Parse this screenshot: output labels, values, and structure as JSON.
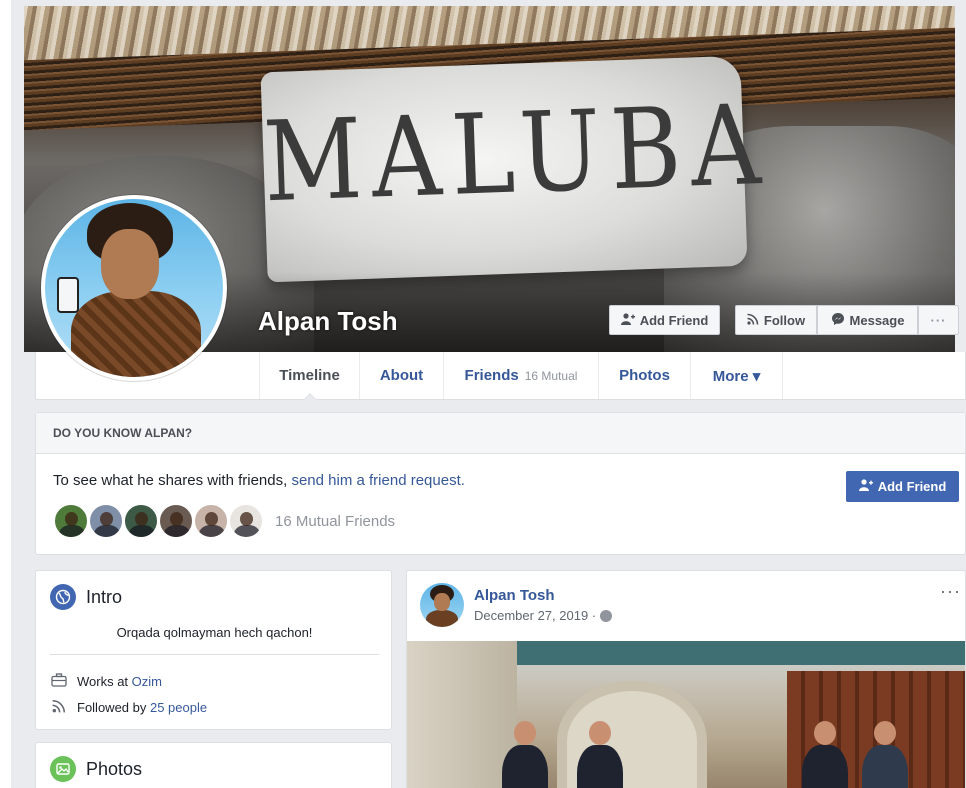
{
  "profile": {
    "name": "Alpan Tosh",
    "cover_text": "MALUBA"
  },
  "cover_actions": {
    "add_friend": "Add Friend",
    "follow": "Follow",
    "message": "Message",
    "more": "···"
  },
  "nav": {
    "tabs": [
      {
        "label": "Timeline",
        "active": true
      },
      {
        "label": "About"
      },
      {
        "label": "Friends",
        "count": "16 Mutual"
      },
      {
        "label": "Photos"
      },
      {
        "label": "More ▾"
      }
    ]
  },
  "know": {
    "header": "DO YOU KNOW ALPAN?",
    "text": "To see what he shares with friends, ",
    "link": "send him a friend request.",
    "button": "Add Friend",
    "mutual": "16 Mutual Friends",
    "avatar_colors": [
      "#4e7a3a",
      "#7f8fa8",
      "#3c5a45",
      "#6a5b52",
      "#c7b3a8",
      "#e8e4e0"
    ]
  },
  "intro": {
    "title": "Intro",
    "bio": "Orqada qolmayman hech qachon!",
    "works_prefix": "Works at ",
    "works_link": "Ozim",
    "followed_prefix": "Followed by ",
    "followed_link": "25 people"
  },
  "photos": {
    "title": "Photos"
  },
  "post": {
    "author": "Alpan Tosh",
    "date": "December 27, 2019 ·",
    "more": "···"
  },
  "colors": {
    "link": "#365899",
    "primary_button": "#4267b2",
    "page_bg": "#e9ebee"
  }
}
